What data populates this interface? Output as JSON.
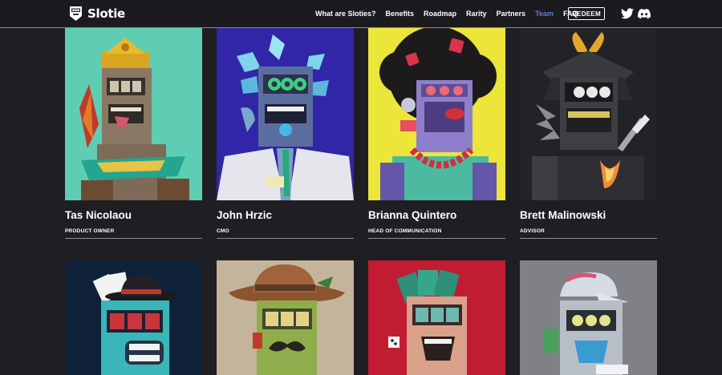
{
  "brand": {
    "name": "Slotie"
  },
  "nav": {
    "links": [
      {
        "label": "What are Sloties?",
        "active": false
      },
      {
        "label": "Benefits",
        "active": false
      },
      {
        "label": "Roadmap",
        "active": false
      },
      {
        "label": "Rarity",
        "active": false
      },
      {
        "label": "Partners",
        "active": false
      },
      {
        "label": "Team",
        "active": true
      },
      {
        "label": "FAQ",
        "active": false
      }
    ],
    "redeem_label": "REDEEM",
    "social": [
      "twitter-icon",
      "discord-icon"
    ]
  },
  "colors": {
    "background": "#1f1e22",
    "active_link": "#5f7ed8",
    "card_backgrounds": [
      "#5fcdb3",
      "#3126a8",
      "#ece53a",
      "#232327",
      "#0f2138",
      "#c5b49c",
      "#c21c33",
      "#7f8187"
    ]
  },
  "team": [
    {
      "name": "Tas Nicolaou",
      "role": "PRODUCT OWNER"
    },
    {
      "name": "John Hrzic",
      "role": "CMO"
    },
    {
      "name": "Brianna Quintero",
      "role": "HEAD OF COMMUNICATION"
    },
    {
      "name": "Brett Malinowski",
      "role": "ADVISOR"
    }
  ]
}
